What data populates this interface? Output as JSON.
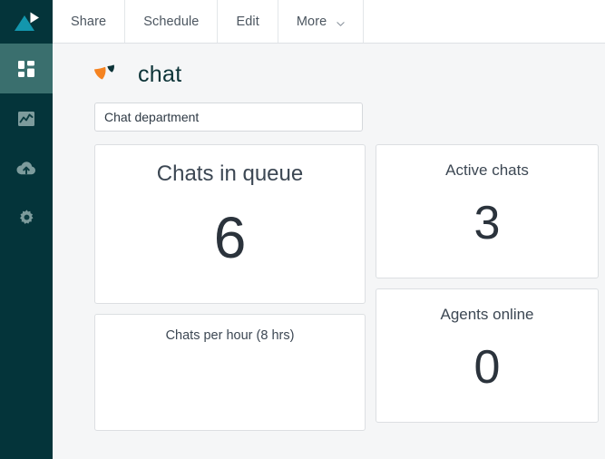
{
  "sidebar": {
    "brand": {
      "icon": "looker-logo-icon",
      "triangle_color": "#1396ad",
      "play_color": "#ffffff"
    },
    "items": [
      {
        "id": "dashboards",
        "label": "Dashboards",
        "icon": "grid-dashboard-icon",
        "active": true
      },
      {
        "id": "explore",
        "label": "Explore",
        "icon": "area-chart-icon",
        "active": false
      },
      {
        "id": "develop",
        "label": "Develop",
        "icon": "cloud-upload-icon",
        "active": false
      },
      {
        "id": "admin",
        "label": "Admin",
        "icon": "gear-icon",
        "active": false
      }
    ],
    "background": "#04343a",
    "active_background": "#3a6f6e",
    "icon_color": "#7d9b9c"
  },
  "toolbar": {
    "buttons": [
      {
        "label": "Share",
        "icon": null
      },
      {
        "label": "Schedule",
        "icon": null
      },
      {
        "label": "Edit",
        "icon": null
      },
      {
        "label": "More",
        "icon": "chevron-down-icon"
      }
    ]
  },
  "dashboard": {
    "logo": {
      "word": "chat",
      "primary_color": "#f58321",
      "secondary_color": "#0d3438"
    },
    "filter": {
      "value": "Chat department",
      "placeholder": "Chat department"
    },
    "tiles": [
      {
        "id": "chats-in-queue",
        "title": "Chats in queue",
        "value": "6",
        "kind": "single-value"
      },
      {
        "id": "active-chats",
        "title": "Active chats",
        "value": "3",
        "kind": "single-value"
      },
      {
        "id": "agents-online",
        "title": "Agents online",
        "value": "0",
        "kind": "single-value"
      },
      {
        "id": "chats-per-hour",
        "title": "Chats per hour (8 hrs)",
        "value": "",
        "kind": "chart"
      }
    ]
  },
  "colors": {
    "page_background": "#f5f6f7",
    "card_background": "#ffffff",
    "card_border": "#dcdfe2",
    "text_primary": "#2b333c",
    "text_secondary": "#4c5660",
    "accent_orange": "#f58321",
    "accent_teal": "#1396ad"
  }
}
